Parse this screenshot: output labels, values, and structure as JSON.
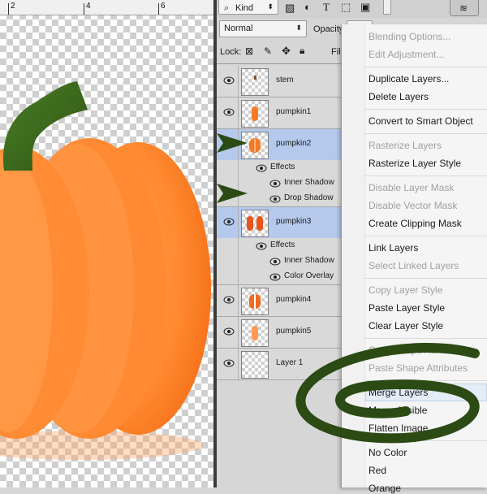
{
  "ruler": {
    "marks": [
      "2",
      "4",
      "6"
    ]
  },
  "toolbar": {
    "filter_kind": "Kind",
    "blend_mode": "Normal",
    "opacity_label": "Opacity",
    "lock_label": "Lock:",
    "fill_label": "Fill"
  },
  "layers": [
    {
      "name": "stem",
      "selected": false
    },
    {
      "name": "pumpkin1",
      "selected": false
    },
    {
      "name": "pumpkin2",
      "selected": true,
      "effects_label": "Effects",
      "effects": [
        "Inner Shadow",
        "Drop Shadow"
      ]
    },
    {
      "name": "pumpkin3",
      "selected": true,
      "effects_label": "Effects",
      "effects": [
        "Inner Shadow",
        "Color Overlay"
      ]
    },
    {
      "name": "pumpkin4",
      "selected": false
    },
    {
      "name": "pumpkin5",
      "selected": false
    },
    {
      "name": "Layer 1",
      "selected": false
    }
  ],
  "context_menu": {
    "items": [
      {
        "label": "Blending Options...",
        "enabled": false
      },
      {
        "label": "Edit Adjustment...",
        "enabled": false
      },
      {
        "label": "Duplicate Layers...",
        "enabled": true
      },
      {
        "label": "Delete Layers",
        "enabled": true
      },
      {
        "label": "Convert to Smart Object",
        "enabled": true
      },
      {
        "label": "Rasterize Layers",
        "enabled": false
      },
      {
        "label": "Rasterize Layer Style",
        "enabled": true
      },
      {
        "label": "Disable Layer Mask",
        "enabled": false
      },
      {
        "label": "Disable Vector Mask",
        "enabled": false
      },
      {
        "label": "Create Clipping Mask",
        "enabled": true
      },
      {
        "label": "Link Layers",
        "enabled": true
      },
      {
        "label": "Select Linked Layers",
        "enabled": false
      },
      {
        "label": "Copy Layer Style",
        "enabled": false
      },
      {
        "label": "Paste Layer Style",
        "enabled": true
      },
      {
        "label": "Clear Layer Style",
        "enabled": true
      },
      {
        "label": "Copy Shape Attributes",
        "enabled": false
      },
      {
        "label": "Paste Shape Attributes",
        "enabled": false
      },
      {
        "label": "Merge Layers",
        "enabled": true
      },
      {
        "label": "Merge Visible",
        "enabled": true
      },
      {
        "label": "Flatten Image",
        "enabled": true
      },
      {
        "label": "No Color",
        "enabled": true
      },
      {
        "label": "Red",
        "enabled": true
      },
      {
        "label": "Orange",
        "enabled": true
      }
    ]
  },
  "colors": {
    "selection": "#b4c9ec",
    "pumpkin": "#ff8a30",
    "stem": "#3e6b1e",
    "annotation": "#2b4a14"
  }
}
